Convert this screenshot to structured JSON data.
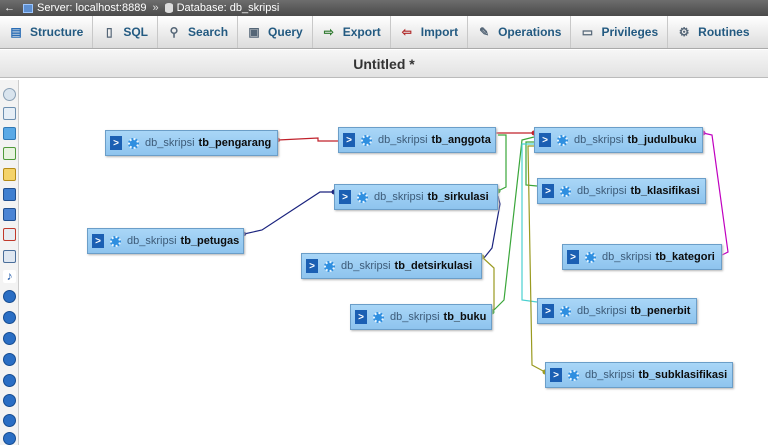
{
  "breadcrumb": {
    "server": "Server: localhost:8889",
    "separator": "»",
    "database": "Database: db_skripsi"
  },
  "tabs": [
    {
      "label": "Structure",
      "icon": "structure-icon"
    },
    {
      "label": "SQL",
      "icon": "sql-icon"
    },
    {
      "label": "Search",
      "icon": "search-icon"
    },
    {
      "label": "Query",
      "icon": "query-icon"
    },
    {
      "label": "Export",
      "icon": "export-icon"
    },
    {
      "label": "Import",
      "icon": "import-icon"
    },
    {
      "label": "Operations",
      "icon": "operations-icon"
    },
    {
      "label": "Privileges",
      "icon": "privileges-icon"
    },
    {
      "label": "Routines",
      "icon": "routines-icon"
    }
  ],
  "designer": {
    "title": "Untitled *"
  },
  "tables": [
    {
      "db": "db_skripsi",
      "name": "tb_pengarang"
    },
    {
      "db": "db_skripsi",
      "name": "tb_anggota"
    },
    {
      "db": "db_skripsi",
      "name": "tb_judulbuku"
    },
    {
      "db": "db_skripsi",
      "name": "tb_sirkulasi"
    },
    {
      "db": "db_skripsi",
      "name": "tb_klasifikasi"
    },
    {
      "db": "db_skripsi",
      "name": "tb_petugas"
    },
    {
      "db": "db_skripsi",
      "name": "tb_kategori"
    },
    {
      "db": "db_skripsi",
      "name": "tb_detsirkulasi"
    },
    {
      "db": "db_skripsi",
      "name": "tb_buku"
    },
    {
      "db": "db_skripsi",
      "name": "tb_penerbit"
    },
    {
      "db": "db_skripsi",
      "name": "tb_subklasifikasi"
    }
  ],
  "colors": {
    "relation_red": "#c0202a",
    "relation_blue": "#1a237e",
    "relation_green": "#3aa63a",
    "relation_magenta": "#c000c0",
    "relation_cyan": "#4ad0d0",
    "relation_olive": "#9a9a20",
    "table_header": "#9ccdf3"
  }
}
